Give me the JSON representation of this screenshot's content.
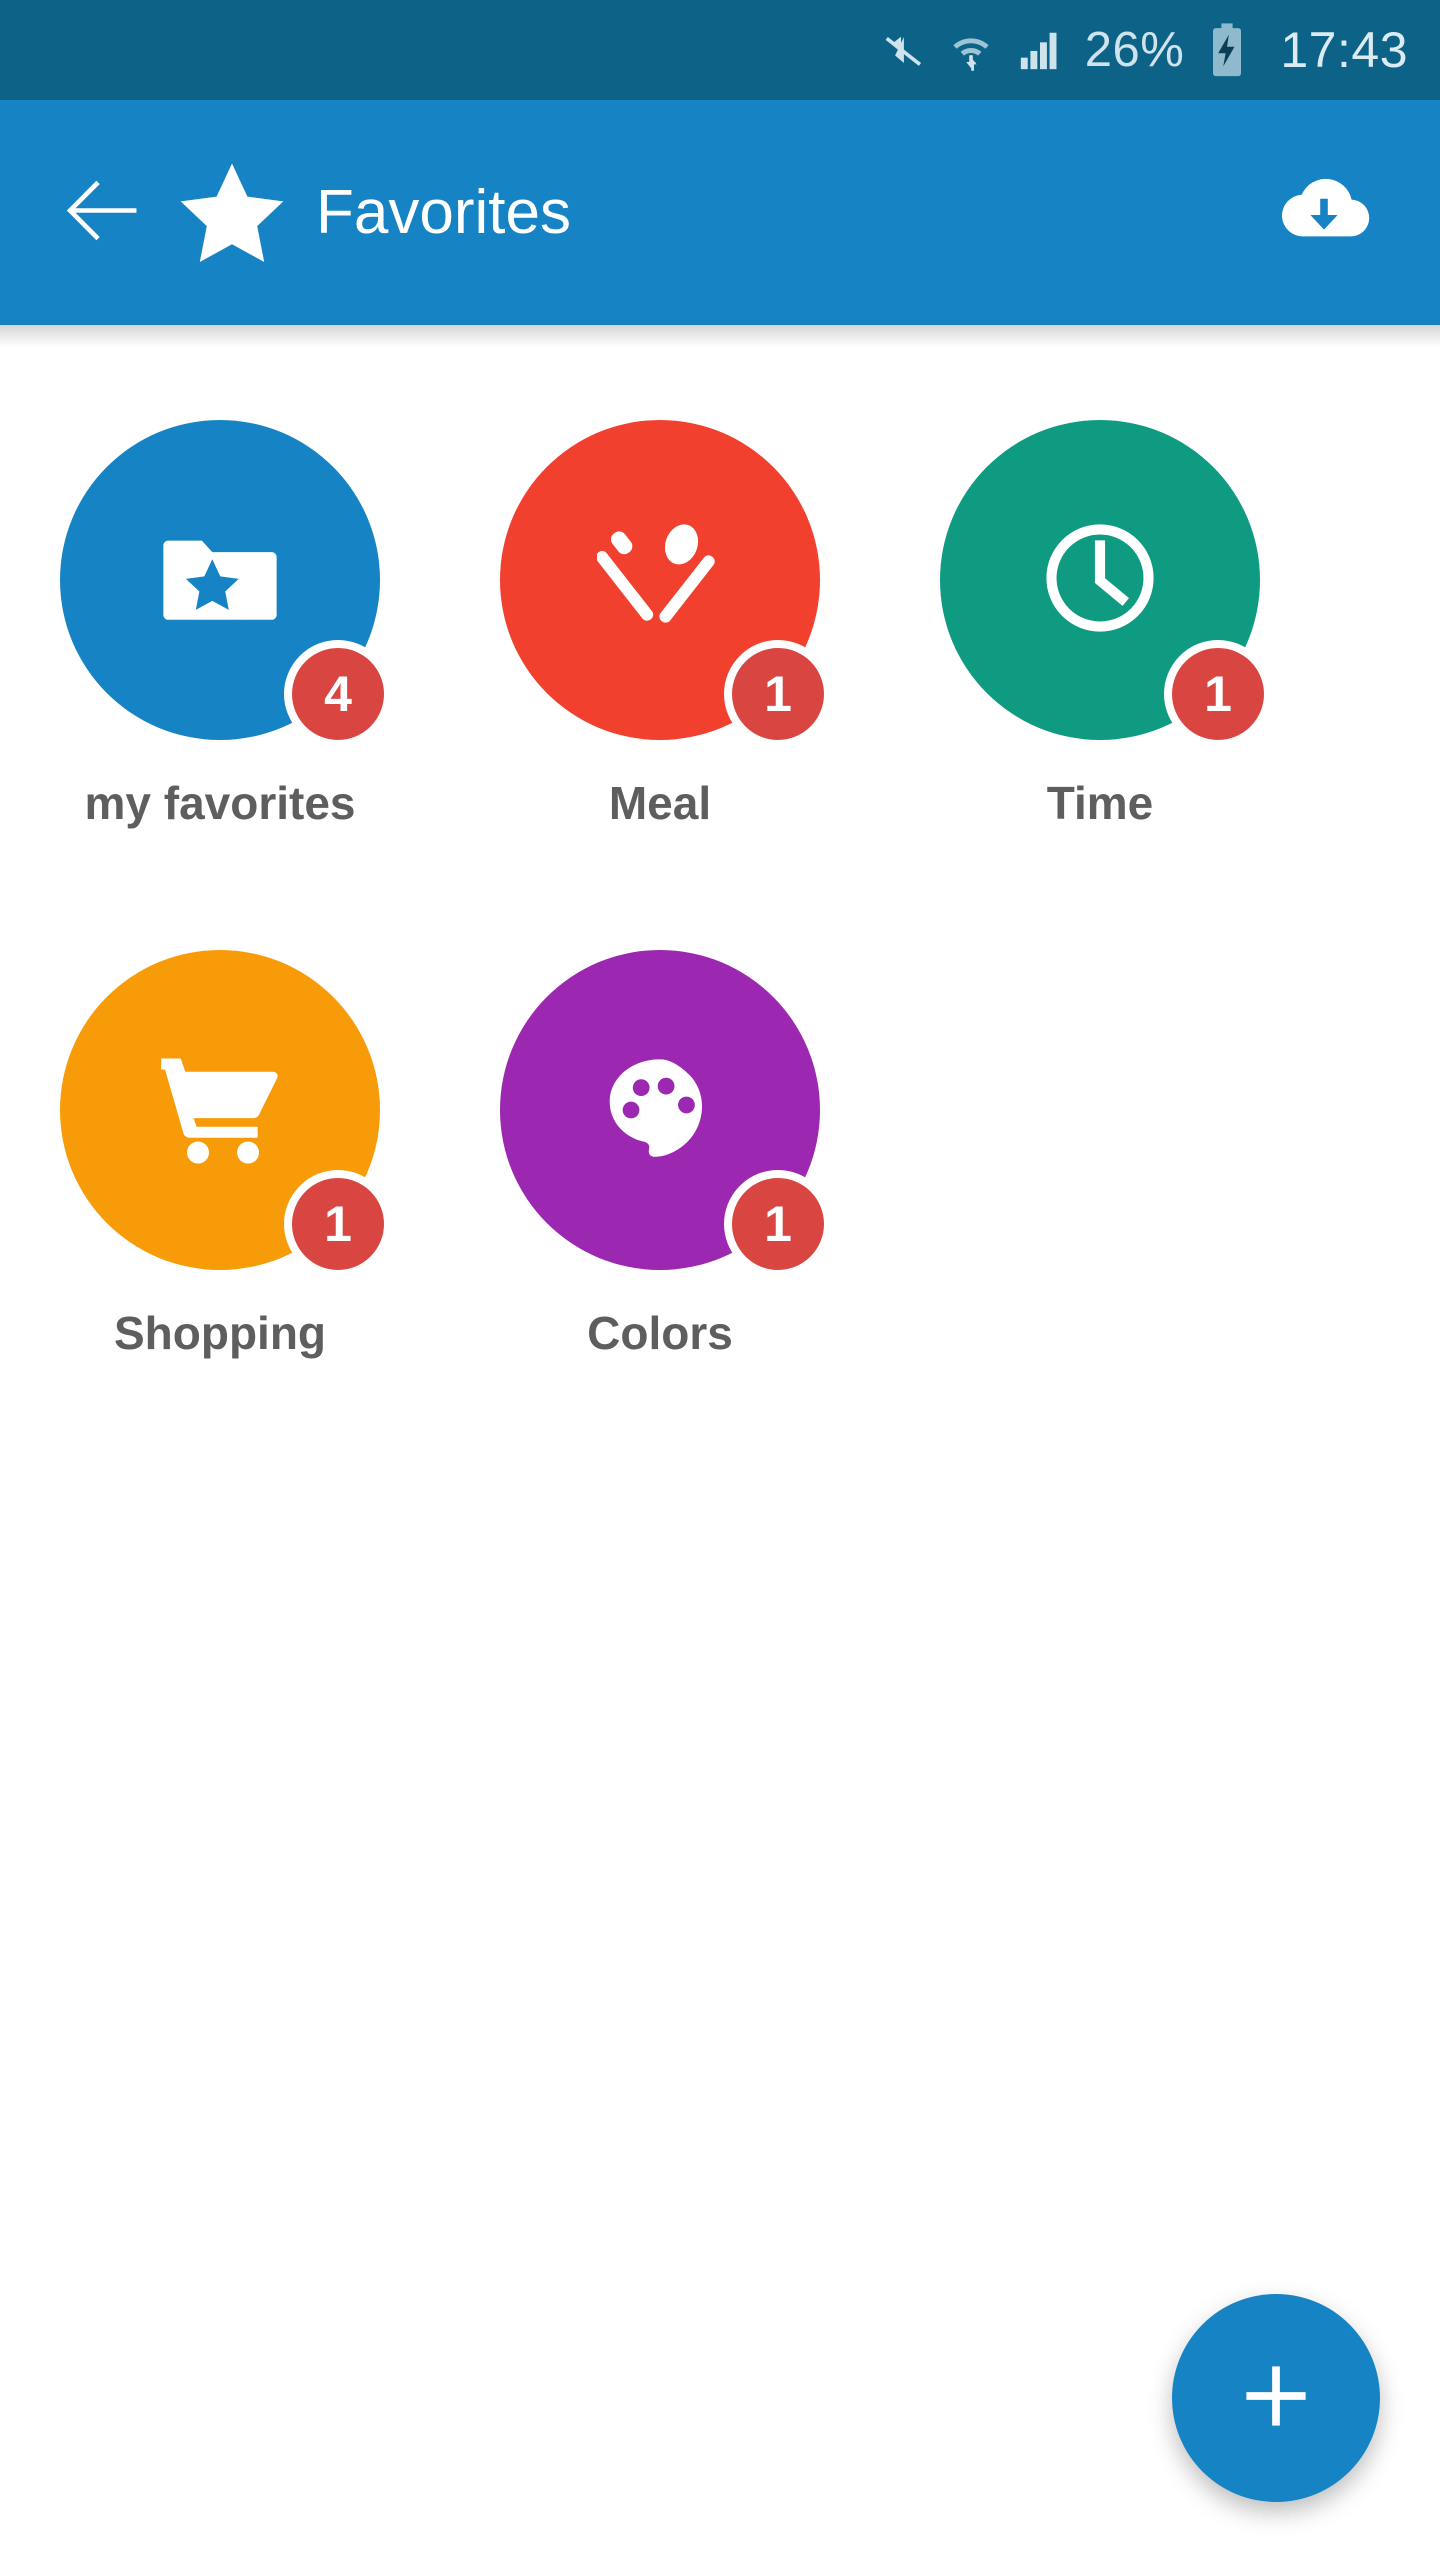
{
  "status_bar": {
    "background": "#0c6387",
    "icons": [
      "mute-icon",
      "wifi-icon",
      "signal-icon",
      "battery-charging-icon"
    ],
    "battery_percent": "26%",
    "time": "17:43"
  },
  "app_bar": {
    "background": "#1683c4",
    "back_label": "back-arrow-icon",
    "brand_icon": "star-icon",
    "title": "Favorites",
    "action_icon": "cloud-download-icon"
  },
  "grid": {
    "items": [
      {
        "label": "my favorites",
        "badge": "4",
        "color": "#1683c4",
        "icon": "folder-star-icon"
      },
      {
        "label": "Meal",
        "badge": "1",
        "color": "#f2402e",
        "icon": "cutlery-icon"
      },
      {
        "label": "Time",
        "badge": "1",
        "color": "#0f9b81",
        "icon": "clock-icon"
      },
      {
        "label": "Shopping",
        "badge": "1",
        "color": "#f89b09",
        "icon": "shopping-cart-icon"
      },
      {
        "label": "Colors",
        "badge": "1",
        "color": "#9c27b0",
        "icon": "palette-icon"
      }
    ],
    "badge_color": "#d94641",
    "label_color": "#5e5e5e"
  },
  "fab": {
    "icon": "plus-icon",
    "color": "#1683c4"
  }
}
